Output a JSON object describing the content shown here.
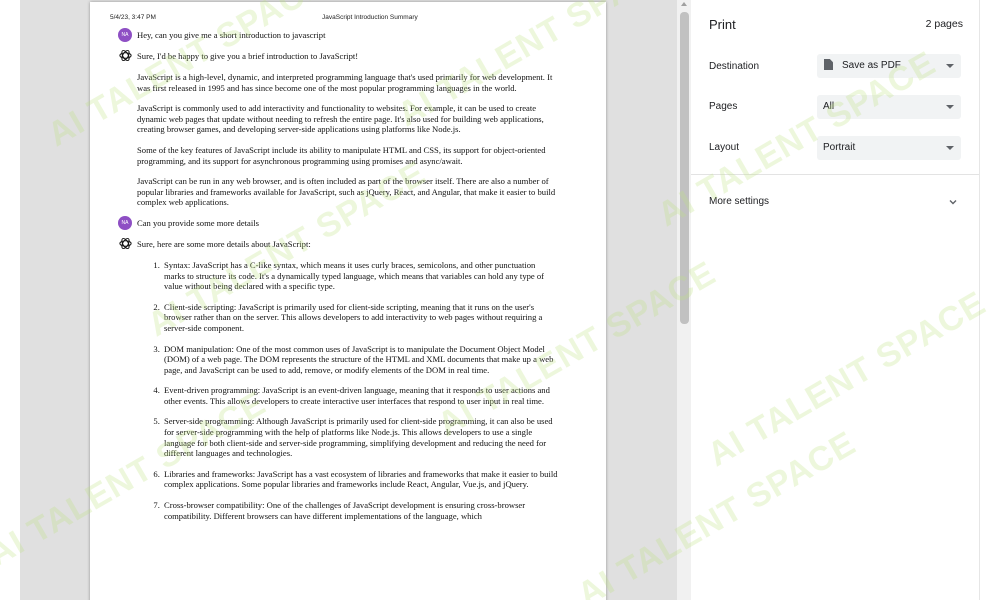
{
  "preview": {
    "header_date": "5/4/23, 3:47 PM",
    "header_title": "JavaScript Introduction Summary"
  },
  "chat": {
    "user_avatar": "NA",
    "q1": "Hey, can you give me a short introduction to javascript",
    "a1_intro": "Sure, I'd be happy to give you a brief introduction to JavaScript!",
    "a1_paragraphs": [
      "JavaScript is a high-level, dynamic, and interpreted programming language that's used primarily for web development. It was first released in 1995 and has since become one of the most popular programming languages in the world.",
      "JavaScript is commonly used to add interactivity and functionality to websites. For example, it can be used to create dynamic web pages that update without needing to refresh the entire page. It's also used for building web applications, creating browser games, and developing server-side applications using platforms like Node.js.",
      "Some of the key features of JavaScript include its ability to manipulate HTML and CSS, its support for object-oriented programming, and its support for asynchronous programming using promises and async/await.",
      "JavaScript can be run in any web browser, and is often included as part of the browser itself. There are also a number of popular libraries and frameworks available for JavaScript, such as jQuery, React, and Angular, that make it easier to build complex web applications."
    ],
    "q2": "Can you provide some more details",
    "a2_intro": "Sure, here are some more details about JavaScript:",
    "a2_items": [
      "Syntax: JavaScript has a C-like syntax, which means it uses curly braces, semicolons, and other punctuation marks to structure its code. It's a dynamically typed language, which means that variables can hold any type of value without being declared with a specific type.",
      "Client-side scripting: JavaScript is primarily used for client-side scripting, meaning that it runs on the user's browser rather than on the server. This allows developers to add interactivity to web pages without requiring a server-side component.",
      "DOM manipulation: One of the most common uses of JavaScript is to manipulate the Document Object Model (DOM) of a web page. The DOM represents the structure of the HTML and XML documents that make up a web page, and JavaScript can be used to add, remove, or modify elements of the DOM in real time.",
      "Event-driven programming: JavaScript is an event-driven language, meaning that it responds to user actions and other events. This allows developers to create interactive user interfaces that respond to user input in real time.",
      "Server-side programming: Although JavaScript is primarily used for client-side programming, it can also be used for server-side programming with the help of platforms like Node.js. This allows developers to use a single language for both client-side and server-side programming, simplifying development and reducing the need for different languages and technologies.",
      "Libraries and frameworks: JavaScript has a vast ecosystem of libraries and frameworks that make it easier to build complex applications. Some popular libraries and frameworks include React, Angular, Vue.js, and jQuery.",
      "Cross-browser compatibility: One of the challenges of JavaScript development is ensuring cross-browser compatibility. Different browsers can have different implementations of the language, which"
    ]
  },
  "panel": {
    "title": "Print",
    "page_count": "2 pages",
    "destination_label": "Destination",
    "destination_value": "Save as PDF",
    "pages_label": "Pages",
    "pages_value": "All",
    "layout_label": "Layout",
    "layout_value": "Portrait",
    "more_settings": "More settings"
  },
  "watermark_text": "AI TALENT SPACE",
  "colors": {
    "avatar": "#8e4fc4",
    "watermark": "#bee182"
  }
}
